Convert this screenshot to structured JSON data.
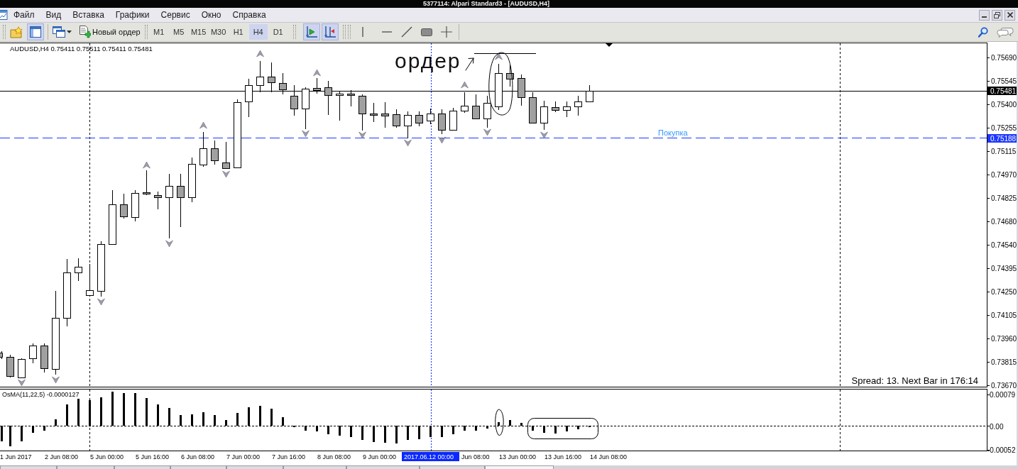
{
  "window": {
    "title": "5377114: Alpari Standard3 - [AUDUSD,H4]"
  },
  "menu": [
    "Файл",
    "Вид",
    "Вставка",
    "Графики",
    "Сервис",
    "Окно",
    "Справка"
  ],
  "toolbar": {
    "toggles": [
      {
        "kind": "folder-star",
        "on": false
      },
      {
        "kind": "panel",
        "on": true
      },
      {
        "kind": "windows",
        "on": false
      }
    ],
    "new_order": "Новый ордер",
    "timeframes": [
      {
        "label": "M1",
        "selected": false
      },
      {
        "label": "M5",
        "selected": false
      },
      {
        "label": "M15",
        "selected": false
      },
      {
        "label": "M30",
        "selected": false
      },
      {
        "label": "H1",
        "selected": false
      },
      {
        "label": "H4",
        "selected": true
      },
      {
        "label": "D1",
        "selected": false
      }
    ],
    "chart_toggles": [
      {
        "kind": "autoscroll",
        "on": true
      },
      {
        "kind": "shift",
        "on": true
      }
    ]
  },
  "chart": {
    "header": "AUDUSD,H4 0.75411 0.75511 0.75411 0.75481",
    "note": "ордер",
    "order_line_label": "Покупка",
    "info": "Spread: 13. Next Bar in 176:14",
    "price_scale": [
      "0.75690",
      "0.75545",
      "0.75400",
      "0.75255",
      "0.75115",
      "0.74970",
      "0.74825",
      "0.74680",
      "0.74540",
      "0.74395",
      "0.74250",
      "0.74105",
      "0.73960",
      "0.73815",
      "0.73670"
    ],
    "bid_price": "0.75481",
    "order_price": "0.75188"
  },
  "indicator": {
    "title": "OsMA(11,22,5) -0.0000127",
    "scale": [
      "0.00079",
      "0.00",
      "-0.00052"
    ]
  },
  "time_axis": {
    "labels": [
      "1 Jun 2017",
      "2 Jun 08:00",
      "5 Jun 00:00",
      "5 Jun 16:00",
      "6 Jun 08:00",
      "7 Jun 00:00",
      "7 Jun 16:00",
      "8 Jun 08:00",
      "9 Jun 00:00",
      "Jun 08:00",
      "13 Jun 00:00",
      "13 Jun 16:00",
      "14 Jun 08:00"
    ],
    "cursor_time": "2017.06.12 00:00"
  },
  "tab_bar": {
    "tabs": [
      {
        "selected": false
      },
      {
        "selected": false
      },
      {
        "selected": false
      },
      {
        "selected": false
      },
      {
        "selected": false
      },
      {
        "selected": false
      },
      {
        "selected": false
      },
      {
        "selected": false
      },
      {
        "selected": true
      }
    ]
  }
}
